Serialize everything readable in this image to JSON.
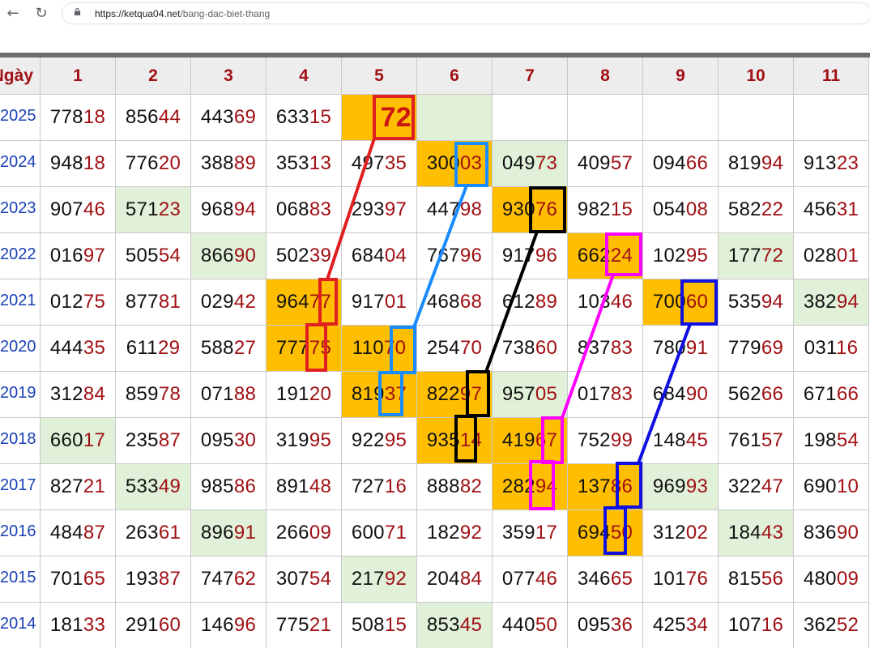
{
  "browser": {
    "url_host": "ketqua04.net",
    "url_path": "/bang-dac-biet-thang",
    "url_scheme": "https://",
    "icons": [
      "back-arrow-icon",
      "reload-icon",
      "lock-icon"
    ]
  },
  "table": {
    "corner_label": "Ngày",
    "months": [
      "1",
      "2",
      "3",
      "4",
      "5",
      "6",
      "7",
      "8",
      "9",
      "10",
      "11"
    ],
    "rows": [
      {
        "year": "2025",
        "cells": [
          "77818",
          "85644",
          "44369",
          "63315",
          "72",
          "",
          "",
          "",
          "",
          "",
          ""
        ]
      },
      {
        "year": "2024",
        "cells": [
          "94818",
          "77620",
          "38889",
          "35313",
          "49735",
          "30003",
          "04973",
          "40957",
          "09466",
          "81994",
          "91323"
        ]
      },
      {
        "year": "2023",
        "cells": [
          "90746",
          "57123",
          "96894",
          "06883",
          "29397",
          "44798",
          "93076",
          "98215",
          "05408",
          "58222",
          "45631"
        ]
      },
      {
        "year": "2022",
        "cells": [
          "01697",
          "50554",
          "86690",
          "50239",
          "68404",
          "76796",
          "91796",
          "66224",
          "10295",
          "17772",
          "02801"
        ]
      },
      {
        "year": "2021",
        "cells": [
          "01275",
          "87781",
          "02942",
          "96477",
          "91701",
          "46868",
          "61289",
          "10346",
          "70060",
          "53594",
          "38294"
        ]
      },
      {
        "year": "2020",
        "cells": [
          "44435",
          "61129",
          "58827",
          "77775",
          "11070",
          "25470",
          "73860",
          "83783",
          "78091",
          "77969",
          "03116"
        ]
      },
      {
        "year": "2019",
        "cells": [
          "31284",
          "85978",
          "07188",
          "19120",
          "81937",
          "82297",
          "95705",
          "01783",
          "68490",
          "56266",
          "67166"
        ]
      },
      {
        "year": "2018",
        "cells": [
          "66017",
          "23587",
          "09530",
          "31995",
          "92295",
          "93514",
          "41967",
          "75299",
          "14845",
          "76157",
          "19854"
        ]
      },
      {
        "year": "2017",
        "cells": [
          "82721",
          "53349",
          "98586",
          "89148",
          "72716",
          "88882",
          "28294",
          "13786",
          "96993",
          "32247",
          "69010"
        ]
      },
      {
        "year": "2016",
        "cells": [
          "48487",
          "26361",
          "89691",
          "26609",
          "60071",
          "18292",
          "35917",
          "69450",
          "31202",
          "18443",
          "83690"
        ]
      },
      {
        "year": "2015",
        "cells": [
          "70165",
          "19387",
          "74762",
          "30754",
          "21792",
          "20484",
          "07746",
          "34665",
          "10176",
          "81556",
          "48009"
        ]
      },
      {
        "year": "2014",
        "cells": [
          "18133",
          "29160",
          "14696",
          "77521",
          "50815",
          "85345",
          "44050",
          "09536",
          "42534",
          "10716",
          "36252"
        ]
      }
    ],
    "highlight_colors": {
      "tail_digits": "#a01014",
      "year_text": "#1a3fb5",
      "orange": "#ffbf00",
      "green": "#e1f0d8"
    }
  },
  "annotations": {
    "colors": {
      "red": "#e02020",
      "blue": "#1a8cff",
      "black": "#000000",
      "magenta": "#ff00ff",
      "navy": "#1010e0"
    }
  }
}
